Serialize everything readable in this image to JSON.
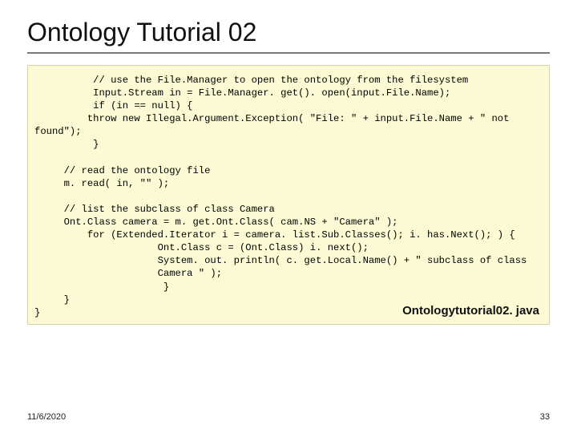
{
  "title": "Ontology Tutorial 02",
  "code": "          // use the File.Manager to open the ontology from the filesystem\n          Input.Stream in = File.Manager. get(). open(input.File.Name);\n          if (in == null) {\n         throw new Illegal.Argument.Exception( \"File: \" + input.File.Name + \" not\nfound\");\n          }\n\n     // read the ontology file\n     m. read( in, \"\" );\n\n     // list the subclass of class Camera\n     Ont.Class camera = m. get.Ont.Class( cam.NS + \"Camera\" );\n         for (Extended.Iterator i = camera. list.Sub.Classes(); i. has.Next(); ) {\n                     Ont.Class c = (Ont.Class) i. next();\n                     System. out. println( c. get.Local.Name() + \" subclass of class\n                     Camera \" );\n                      }\n     }\n}",
  "filename": "Ontologytutorial02. java",
  "footer": {
    "date": "11/6/2020",
    "pageno": "33"
  }
}
